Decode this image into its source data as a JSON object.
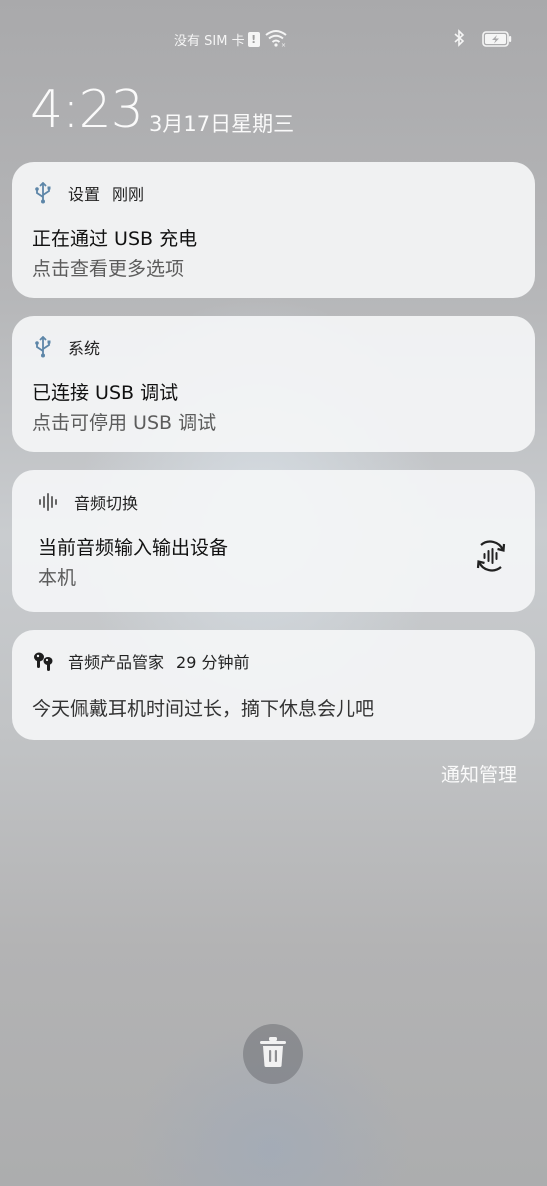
{
  "status_bar": {
    "carrier": "没有 SIM 卡",
    "sim_alert": "!",
    "icons": [
      "sim-alert-icon",
      "wifi-icon",
      "bluetooth-icon",
      "battery-charging-icon"
    ]
  },
  "lock": {
    "time": "4:23",
    "date": "3月17日星期三"
  },
  "notifications": [
    {
      "icon": "usb-icon",
      "app": "设置",
      "time": "刚刚",
      "title": "正在通过 USB 充电",
      "subtitle": "点击查看更多选项"
    },
    {
      "icon": "usb-icon",
      "app": "系统",
      "time": "",
      "title": "已连接 USB 调试",
      "subtitle": "点击可停用 USB 调试"
    },
    {
      "icon": "audio-wave-icon",
      "app": "音频切换",
      "time": "",
      "title": "当前音频输入输出设备",
      "subtitle": "本机",
      "action_icon": "audio-switch-icon"
    },
    {
      "icon": "earbuds-icon",
      "app": "音频产品管家",
      "time": "29 分钟前",
      "title": "",
      "subtitle": "今天佩戴耳机时间过长，摘下休息会儿吧"
    }
  ],
  "manage_label": "通知管理",
  "clear_icon": "trash-icon",
  "colors": {
    "card_bg": "#f4f5f6",
    "usb_icon": "#5d86a8",
    "text_light": "#fafafa"
  }
}
